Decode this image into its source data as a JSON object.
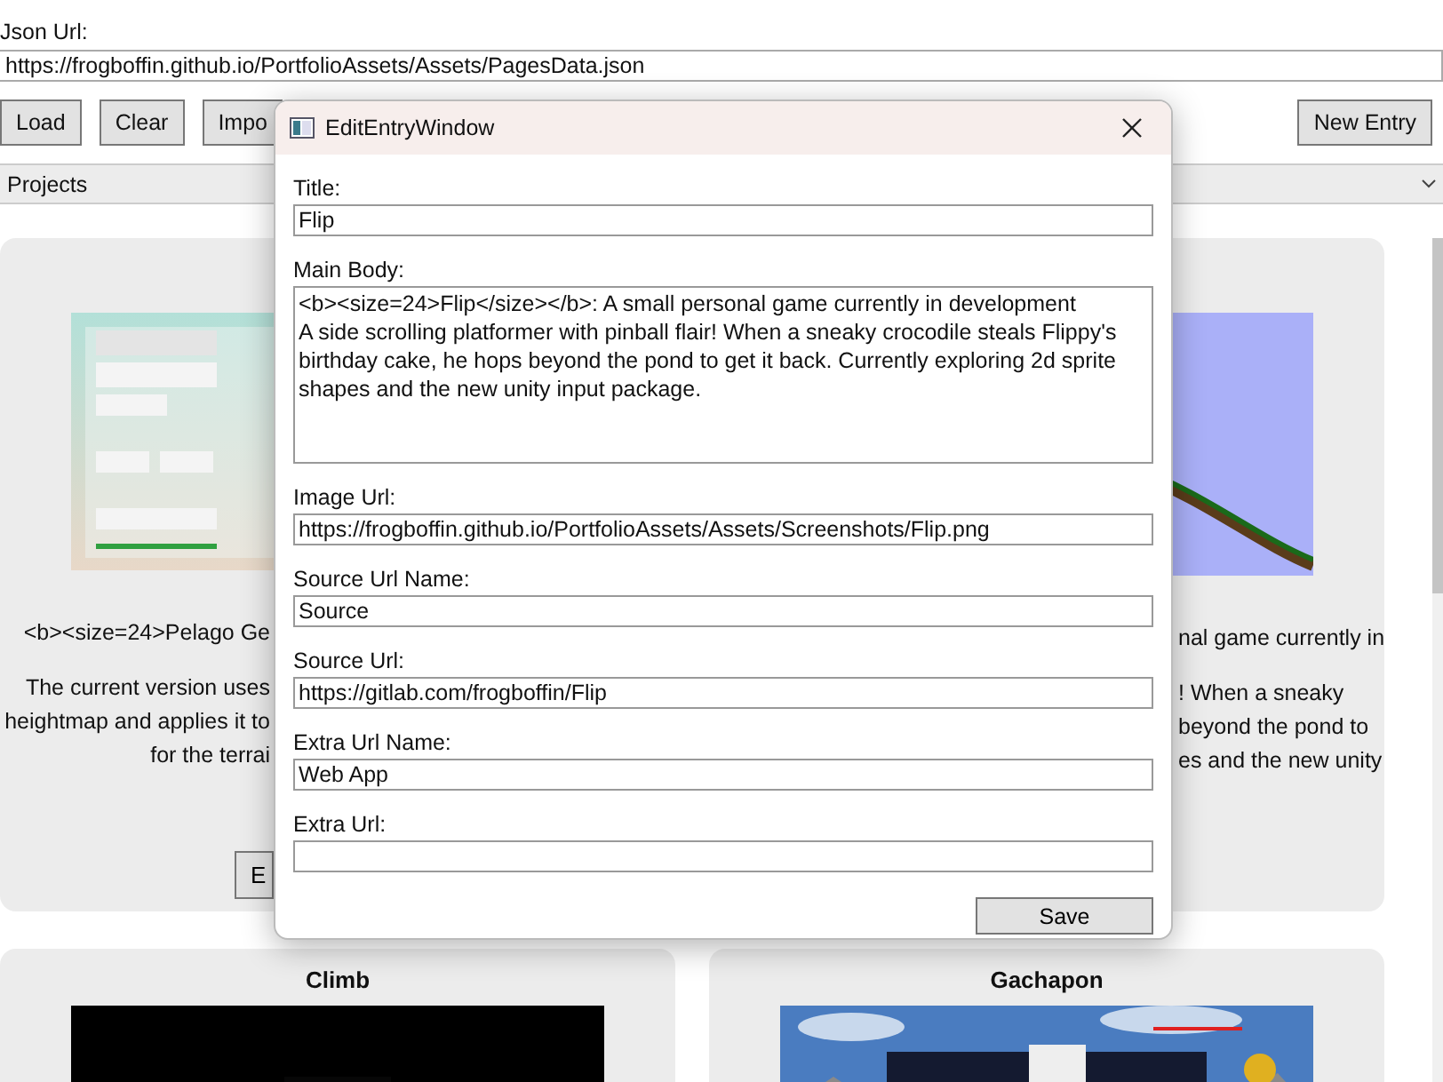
{
  "json_url": {
    "label": "Json Url:",
    "value": "https://frogboffin.github.io/PortfolioAssets/Assets/PagesData.json"
  },
  "toolbar": {
    "left": [
      "Load",
      "Clear",
      "Impo"
    ],
    "right": [
      "New Entry"
    ]
  },
  "projects": {
    "label": "Projects"
  },
  "cards": [
    {
      "heading": "<b><size=24>Pelago Ge",
      "lines": [
        "The current version uses",
        "heightmap and applies it to",
        "for the terrai"
      ],
      "button": "E",
      "image": {
        "kind": "picture"
      }
    },
    {
      "heading": "nal game currently in",
      "lines": [
        "! When a sneaky",
        "beyond the pond to",
        "es and the new unity"
      ],
      "image": {
        "kind": "picture"
      }
    },
    {
      "title": "Climb",
      "image": {
        "kind": "picture"
      }
    },
    {
      "title": "Gachapon",
      "image": {
        "kind": "picture"
      }
    }
  ],
  "dialog": {
    "title": "EditEntryWindow",
    "fields": [
      {
        "label": "Title:",
        "value": "Flip",
        "kind": "line"
      },
      {
        "label": "Main Body:",
        "value": "<b><size=24>Flip</size></b>: A small personal game currently in development\nA side scrolling platformer with pinball flair! When a sneaky crocodile steals Flippy's birthday cake, he hops beyond the pond to get it back. Currently exploring 2d sprite shapes and the new unity input package.",
        "kind": "multiline"
      },
      {
        "label": "Image Url:",
        "value": "https://frogboffin.github.io/PortfolioAssets/Assets/Screenshots/Flip.png",
        "kind": "line"
      },
      {
        "label": "Source Url Name:",
        "value": "Source",
        "kind": "line"
      },
      {
        "label": "Source Url:",
        "value": "https://gitlab.com/frogboffin/Flip",
        "kind": "line"
      },
      {
        "label": "Extra Url Name:",
        "value": "Web App",
        "kind": "line"
      },
      {
        "label": "Extra Url:",
        "kind": "line"
      }
    ],
    "button": "Save"
  }
}
